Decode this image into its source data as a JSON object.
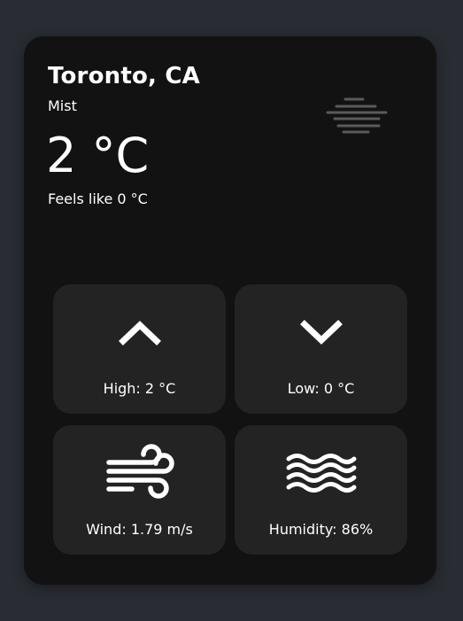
{
  "location": {
    "city": "Toronto, CA"
  },
  "current": {
    "condition": "Mist",
    "condition_icon": "mist-icon",
    "temperature": "2 °C",
    "feels_like": "Feels like 0 °C"
  },
  "tiles": {
    "high": {
      "label": "High: 2 °C",
      "icon": "chevron-up-icon"
    },
    "low": {
      "label": "Low: 0 °C",
      "icon": "chevron-down-icon"
    },
    "wind": {
      "label": "Wind: 1.79 m/s",
      "icon": "wind-icon"
    },
    "humidity": {
      "label": "Humidity: 86%",
      "icon": "waves-icon"
    }
  },
  "colors": {
    "page_background": "#292c33",
    "card_background": "#121212",
    "tile_background": "#232323",
    "text": "#ffffff",
    "mist_icon": "#5a5a5a"
  }
}
